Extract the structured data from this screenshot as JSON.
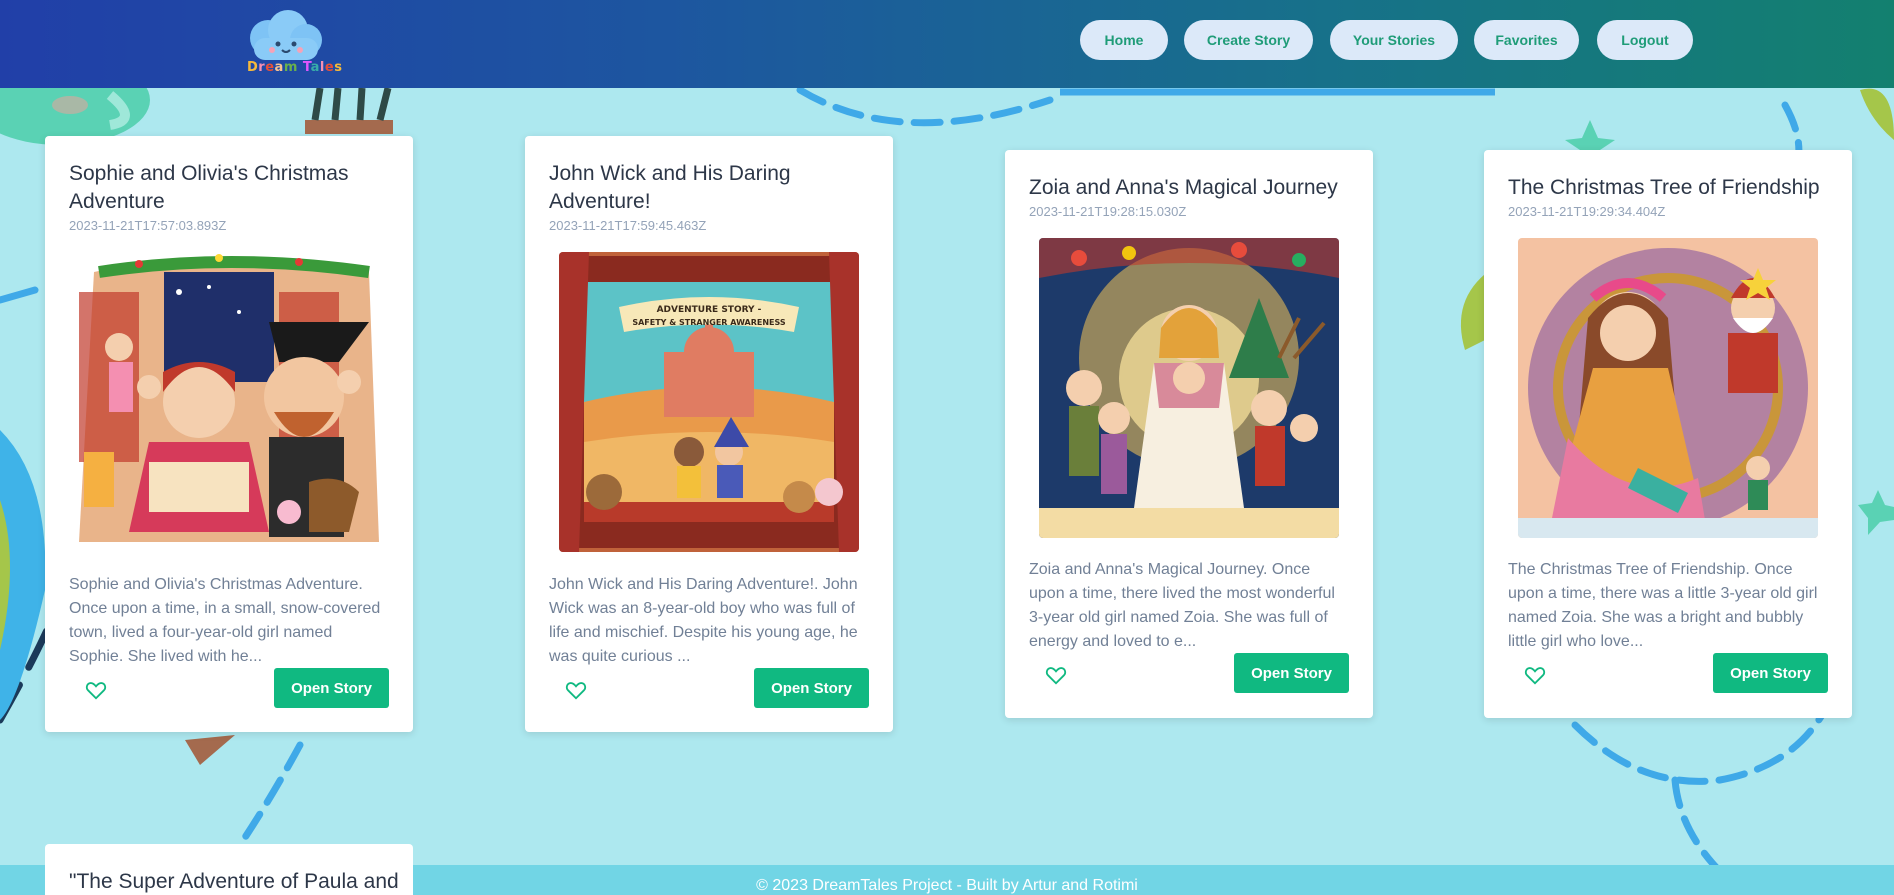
{
  "header": {
    "logo_text": "DreamTales",
    "nav": [
      {
        "label": "Home"
      },
      {
        "label": "Create Story"
      },
      {
        "label": "Your Stories"
      },
      {
        "label": "Favorites"
      },
      {
        "label": "Logout"
      }
    ],
    "colors": {
      "gradient_start": "#213fa8",
      "gradient_end": "#13806f",
      "nav_bg": "#dce9f9",
      "nav_text": "#1f9c78"
    }
  },
  "stories": [
    {
      "title": "Sophie and Olivia's Christmas Adventure",
      "date": "2023-11-21T17:57:03.893Z",
      "excerpt": "Sophie and Olivia's Christmas Adventure. Once upon a time, in a small, snow-covered town, lived a four-year-old girl named Sophie. She lived with he...",
      "open_label": "Open Story",
      "favorite_icon": "heart-outline-icon"
    },
    {
      "title": "John Wick and His Daring Adventure!",
      "date": "2023-11-21T17:59:45.463Z",
      "excerpt": "John Wick and His Daring Adventure!. John Wick was an 8-year-old boy who was full of life and mischief. Despite his young age, he was quite curious ...",
      "open_label": "Open Story",
      "favorite_icon": "heart-outline-icon",
      "image_banner_line1": "ADVENTURE STORY -",
      "image_banner_line2": "SAFETY & STRANGER AWARENESS"
    },
    {
      "title": "Zoia and Anna's Magical Journey",
      "date": "2023-11-21T19:28:15.030Z",
      "excerpt": "Zoia and Anna's Magical Journey. Once upon a time, there lived the most wonderful 3-year old girl named Zoia. She was full of energy and loved to e...",
      "open_label": "Open Story",
      "favorite_icon": "heart-outline-icon"
    },
    {
      "title": "The Christmas Tree of Friendship",
      "date": "2023-11-21T19:29:34.404Z",
      "excerpt": "The Christmas Tree of Friendship. Once upon a time, there was a little 3-year old girl named Zoia. She was a bright and bubbly little girl who love...",
      "open_label": "Open Story",
      "favorite_icon": "heart-outline-icon"
    },
    {
      "title": "\"The Super Adventure of Paula and"
    }
  ],
  "footer": {
    "text": "© 2023 DreamTales Project - Built by Artur and Rotimi"
  },
  "accent_color": "#10b981"
}
